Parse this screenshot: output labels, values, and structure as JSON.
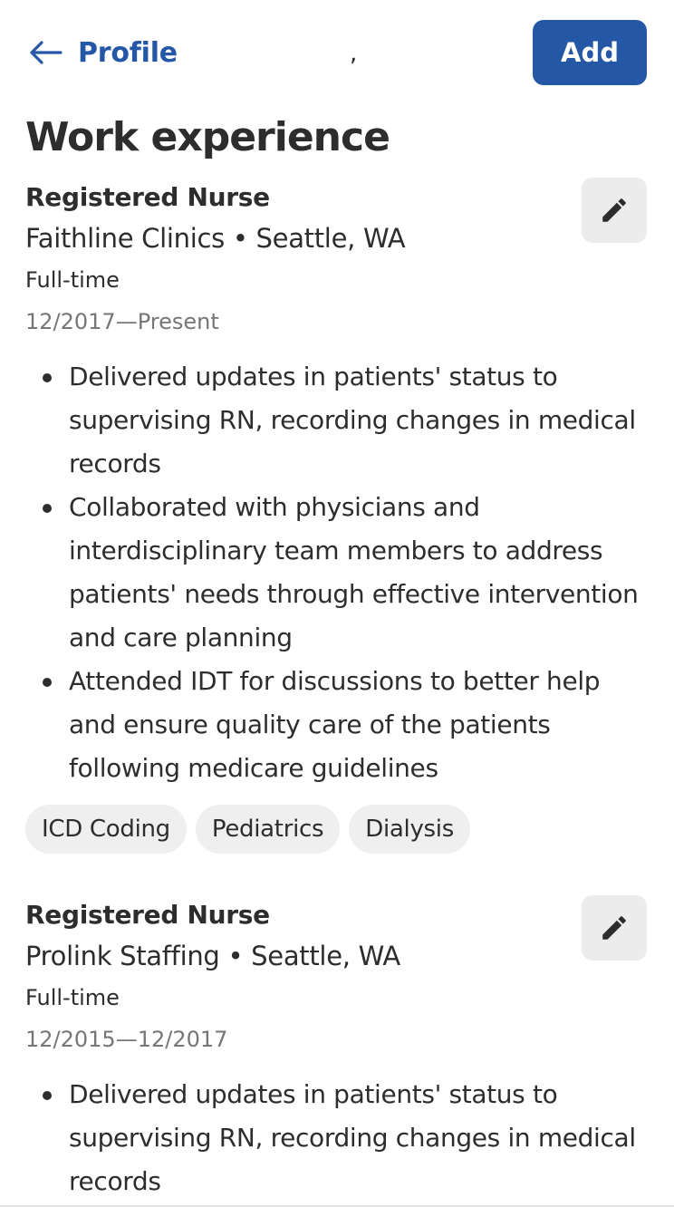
{
  "header": {
    "back_label": "Profile",
    "stray_text": ",",
    "add_label": "Add"
  },
  "page_title": "Work experience",
  "jobs": [
    {
      "title": "Registered Nurse",
      "company_location": "Faithline Clinics • Seattle, WA",
      "employment_type": "Full-time",
      "dates": "12/2017—Present",
      "bullets": [
        "Delivered updates in patients' status to supervising RN, recording changes in medical records",
        "Collaborated with physicians and interdisciplinary team members to address patients' needs through effective intervention and care planning",
        "Attended IDT for discussions to better help and ensure quality care of the patients following medicare guidelines"
      ],
      "skills": [
        "ICD Coding",
        "Pediatrics",
        "Dialysis"
      ]
    },
    {
      "title": "Registered Nurse",
      "company_location": "Prolink Staffing • Seattle, WA",
      "employment_type": "Full-time",
      "dates": "12/2015—12/2017",
      "bullets": [
        "Delivered updates in patients' status to supervising RN, recording changes in medical records"
      ]
    }
  ],
  "colors": {
    "accent": "#2557a7",
    "text": "#2d2d2d",
    "muted": "#767676",
    "chip_bg": "#efefef",
    "edit_bg": "#ececec"
  },
  "icons": {
    "back": "arrow-left-icon",
    "edit": "pencil-icon"
  }
}
